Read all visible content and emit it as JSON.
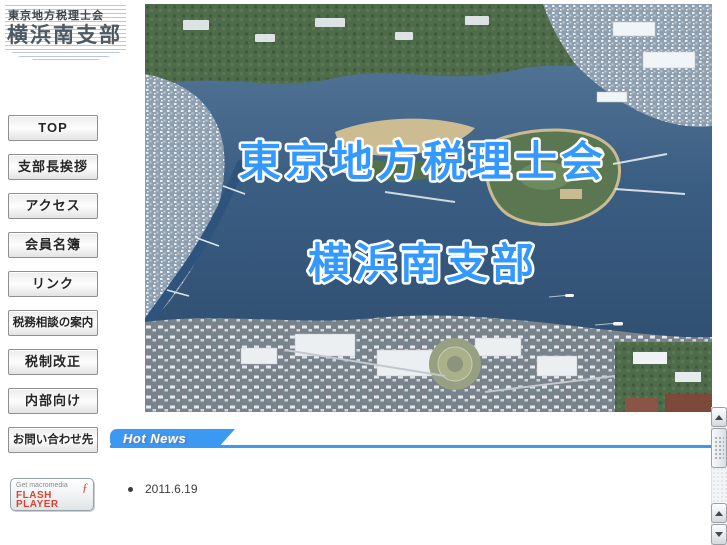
{
  "logo": {
    "line1": "東京地方税理士会",
    "line2": "横浜南支部"
  },
  "sidebar": {
    "items": [
      {
        "label": "TOP"
      },
      {
        "label": "支部長挨拶"
      },
      {
        "label": "アクセス"
      },
      {
        "label": "会員名簿"
      },
      {
        "label": "リンク"
      },
      {
        "label": "税務相談の案内"
      },
      {
        "label": "税制改正"
      },
      {
        "label": "内部向け"
      },
      {
        "label": "お問い合わせ先"
      }
    ]
  },
  "hero": {
    "overlay_line1": "東京地方税理士会",
    "overlay_line2": "横浜南支部"
  },
  "hot_news": {
    "title": "Hot News",
    "items": [
      {
        "date": "2011.6.19"
      }
    ]
  },
  "flash_badge": {
    "prefix": "Get macromedia",
    "line1": "FLASH",
    "line2": "PLAYER"
  },
  "icons": {
    "flash_logo": "ƒ",
    "scroll_up": "triangle-up",
    "scroll_down": "triangle-down",
    "news_bullet": "dot"
  },
  "colors": {
    "accent_blue": "#3399ff",
    "banner_blue": "#3b99f2",
    "flash_red": "#d9432f",
    "stripe_blue": "#bcc8d6"
  }
}
